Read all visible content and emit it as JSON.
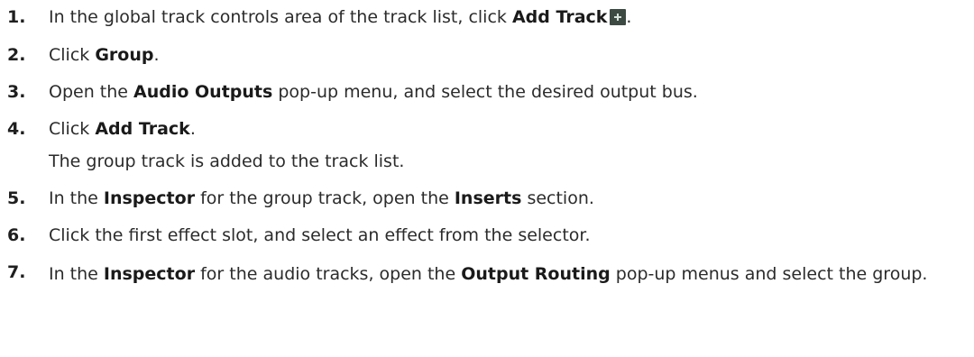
{
  "steps": [
    {
      "number": "1.",
      "pre": "In the global track controls area of the track list, click ",
      "bold1": "Add Track",
      "post": ".",
      "icon": "add-plus-icon"
    },
    {
      "number": "2.",
      "pre": "Click ",
      "bold1": "Group",
      "post": "."
    },
    {
      "number": "3.",
      "pre": "Open the ",
      "bold1": "Audio Outputs",
      "post": " pop-up menu, and select the desired output bus."
    },
    {
      "number": "4.",
      "pre": "Click ",
      "bold1": "Add Track",
      "post": ".",
      "result": "The group track is added to the track list."
    },
    {
      "number": "5.",
      "pre": "In the ",
      "bold1": "Inspector",
      "mid": " for the group track, open the ",
      "bold2": "Inserts",
      "post": " section."
    },
    {
      "number": "6.",
      "text": "Click the first effect slot, and select an effect from the selector."
    },
    {
      "number": "7.",
      "pre": "In the ",
      "bold1": "Inspector",
      "mid": " for the audio tracks, open the ",
      "bold2": "Output Routing",
      "post": " pop-up menus and select the group."
    }
  ],
  "colors": {
    "text": "#2b2b2b",
    "icon_bg": "#3d4a44",
    "icon_fg": "#d8e2dc"
  }
}
